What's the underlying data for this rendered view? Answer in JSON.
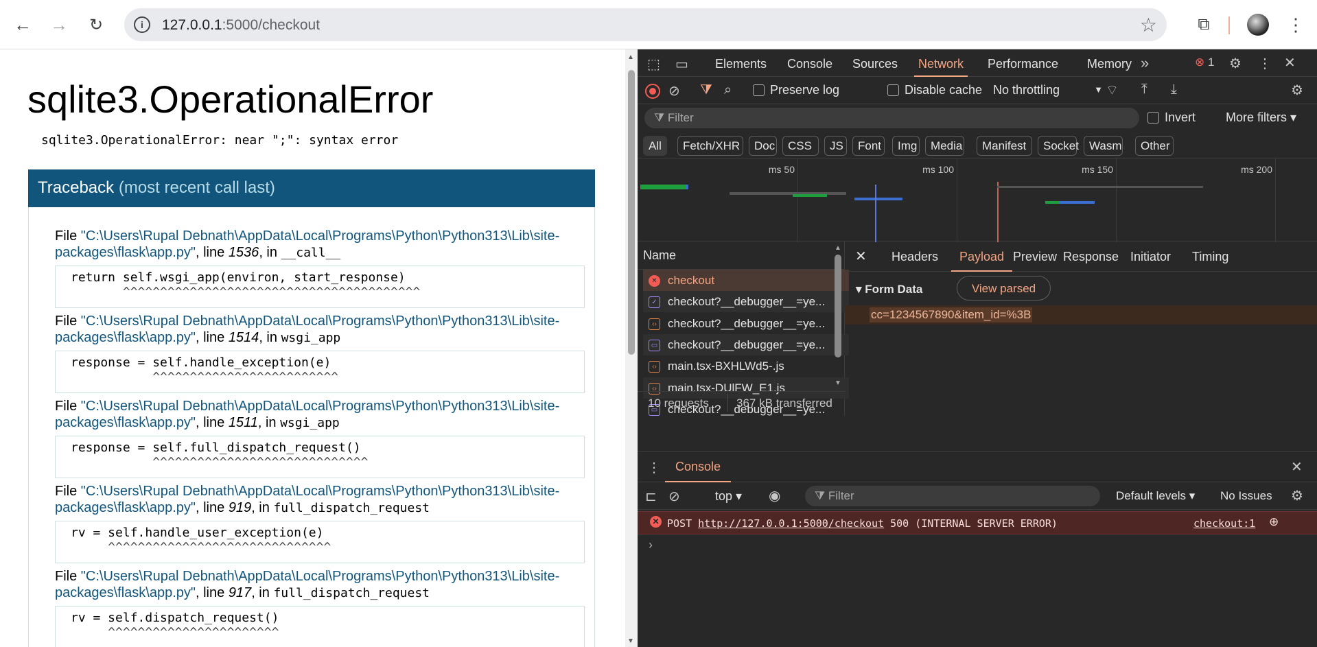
{
  "browser": {
    "url_host": "127.0.0.1",
    "url_rest": ":5000/checkout"
  },
  "page": {
    "title": "sqlite3.OperationalError",
    "message": "sqlite3.OperationalError: near \";\": syntax error",
    "traceback_title": "Traceback",
    "traceback_sub": "(most recent call last)",
    "frames": [
      {
        "path": "\"C:\\Users\\Rupal Debnath\\AppData\\Local\\Programs\\Python\\Python313\\Lib\\site-",
        "path2": "packages\\flask\\app.py\"",
        "line_pre": ", line ",
        "line": "1536",
        "in_pre": ", in ",
        "func": "__call__",
        "code": "return self.wsgi_app(environ, start_response)",
        "caret": "       ^^^^^^^^^^^^^^^^^^^^^^^^^^^^^^^^^^^^^^^^"
      },
      {
        "path": "\"C:\\Users\\Rupal Debnath\\AppData\\Local\\Programs\\Python\\Python313\\Lib\\site-",
        "path2": "packages\\flask\\app.py\"",
        "line_pre": ", line ",
        "line": "1514",
        "in_pre": ", in ",
        "func": "wsgi_app",
        "code": "response = self.handle_exception(e)",
        "caret": "           ^^^^^^^^^^^^^^^^^^^^^^^^^"
      },
      {
        "path": "\"C:\\Users\\Rupal Debnath\\AppData\\Local\\Programs\\Python\\Python313\\Lib\\site-",
        "path2": "packages\\flask\\app.py\"",
        "line_pre": ", line ",
        "line": "1511",
        "in_pre": ", in ",
        "func": "wsgi_app",
        "code": "response = self.full_dispatch_request()",
        "caret": "           ^^^^^^^^^^^^^^^^^^^^^^^^^^^^^"
      },
      {
        "path": "\"C:\\Users\\Rupal Debnath\\AppData\\Local\\Programs\\Python\\Python313\\Lib\\site-",
        "path2": "packages\\flask\\app.py\"",
        "line_pre": ", line ",
        "line": "919",
        "in_pre": ", in ",
        "func": "full_dispatch_request",
        "code": "rv = self.handle_user_exception(e)",
        "caret": "     ^^^^^^^^^^^^^^^^^^^^^^^^^^^^^^"
      },
      {
        "path": "\"C:\\Users\\Rupal Debnath\\AppData\\Local\\Programs\\Python\\Python313\\Lib\\site-",
        "path2": "packages\\flask\\app.py\"",
        "line_pre": ", line ",
        "line": "917",
        "in_pre": ", in ",
        "func": "full_dispatch_request",
        "code": "rv = self.dispatch_request()",
        "caret": "     ^^^^^^^^^^^^^^^^^^^^^^^"
      }
    ]
  },
  "devtools": {
    "tabs": [
      "Elements",
      "Console",
      "Sources",
      "Network",
      "Performance",
      "Memory"
    ],
    "selected_tab": "Network",
    "error_count": "1",
    "toolbar": {
      "preserve_log": "Preserve log",
      "disable_cache": "Disable cache",
      "throttling": "No throttling"
    },
    "filter_placeholder": "Filter",
    "invert": "Invert",
    "more_filters": "More filters",
    "type_filters": [
      "All",
      "Fetch/XHR",
      "Doc",
      "CSS",
      "JS",
      "Font",
      "Img",
      "Media",
      "Manifest",
      "Socket",
      "Wasm",
      "Other"
    ],
    "timeline_ticks": [
      "50 ms",
      "100 ms",
      "150 ms",
      "200 ms"
    ],
    "name_header": "Name",
    "requests": [
      "checkout",
      "checkout?__debugger__=ye...",
      "checkout?__debugger__=ye...",
      "checkout?__debugger__=ye...",
      "main.tsx-BXHLWd5-.js",
      "main.tsx-DUlFW_E1.js",
      "checkout?__debugger__=ye..."
    ],
    "summary": {
      "requests": "10 requests",
      "transferred": "367 kB transferred"
    },
    "detail_tabs": [
      "Headers",
      "Payload",
      "Preview",
      "Response",
      "Initiator",
      "Timing"
    ],
    "selected_detail": "Payload",
    "form_data_label": "Form Data",
    "view_parsed": "View parsed",
    "payload": "cc=1234567890&item_id=%3B",
    "drawer": {
      "title": "Console",
      "context": "top",
      "filter": "Filter",
      "levels": "Default levels",
      "issues": "No Issues"
    },
    "console_error": {
      "method": "POST",
      "url": "http://127.0.0.1:5000/checkout",
      "status": "500 (INTERNAL SERVER ERROR)",
      "source": "checkout:1"
    },
    "colors": {
      "accent": "#f4a584",
      "error": "#f25c54",
      "bg": "#282828"
    }
  }
}
